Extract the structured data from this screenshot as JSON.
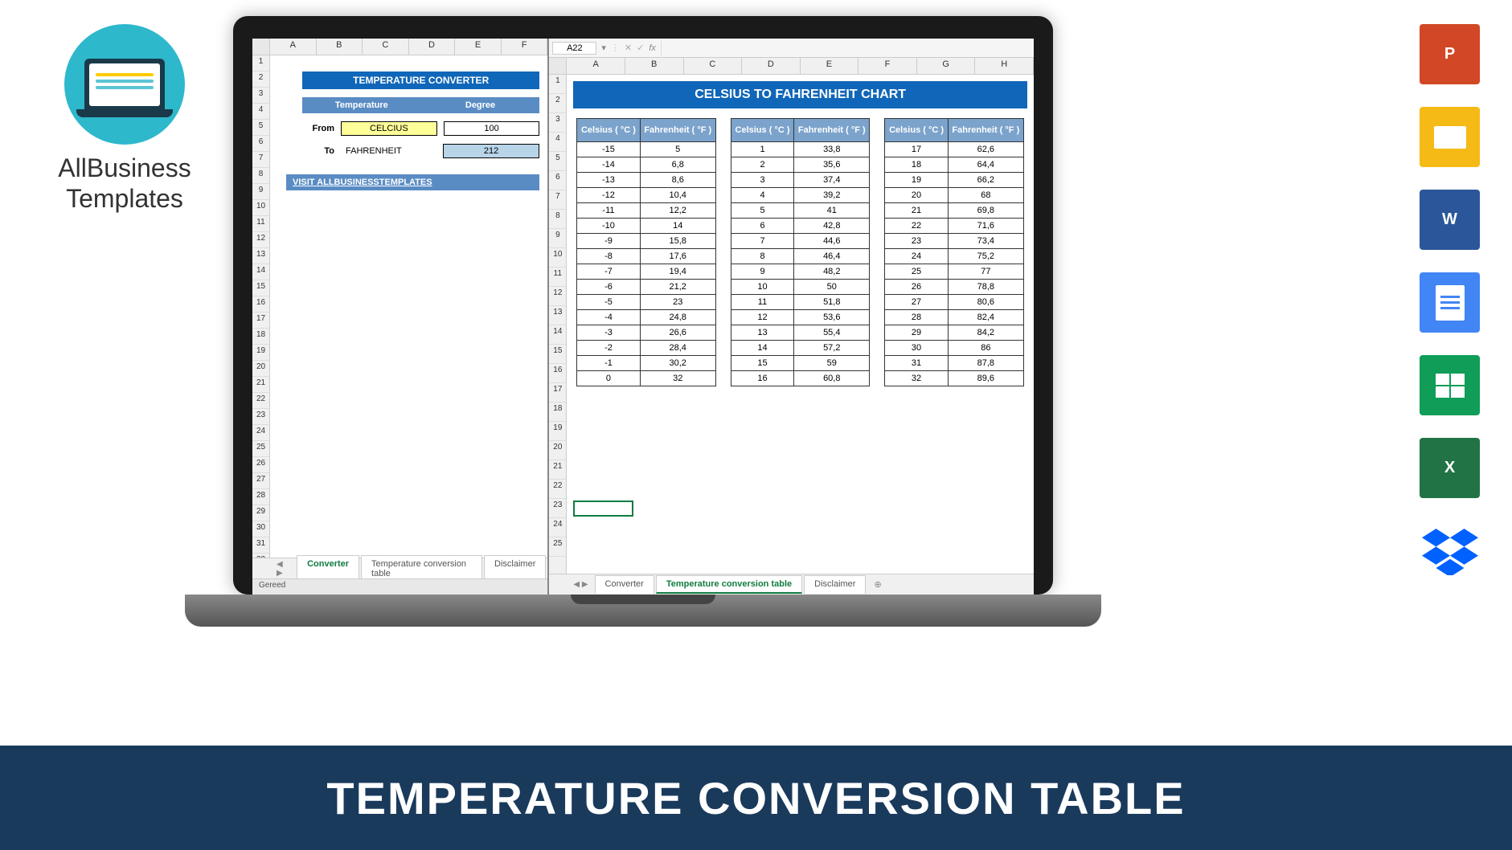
{
  "logo": {
    "text_line1": "AllBusiness",
    "text_line2": "Templates"
  },
  "left_sheet": {
    "columns": [
      "A",
      "B",
      "C",
      "D",
      "E",
      "F"
    ],
    "row_count": 36,
    "converter_title": "TEMPERATURE CONVERTER",
    "header_temp": "Temperature",
    "header_deg": "Degree",
    "from_label": "From",
    "from_temp": "CELCIUS",
    "from_deg": "100",
    "to_label": "To",
    "to_temp": "FAHRENHEIT",
    "to_deg": "212",
    "visit_link": "VISIT ALLBUSINESSTEMPLATES",
    "tabs": [
      "Converter",
      "Temperature conversion table",
      "Disclaimer"
    ],
    "active_tab": 0,
    "status": "Gereed"
  },
  "right_sheet": {
    "name_box": "A22",
    "fx_label": "fx",
    "columns": [
      "A",
      "B",
      "C",
      "D",
      "E",
      "F",
      "G",
      "H"
    ],
    "row_count": 25,
    "chart_title": "CELSIUS TO FAHRENHEIT CHART",
    "col_celsius": "Celsius ( °C )",
    "col_fahrenheit": "Fahrenheit  ( °F )",
    "table1": [
      {
        "c": "-15",
        "f": "5"
      },
      {
        "c": "-14",
        "f": "6,8"
      },
      {
        "c": "-13",
        "f": "8,6"
      },
      {
        "c": "-12",
        "f": "10,4"
      },
      {
        "c": "-11",
        "f": "12,2"
      },
      {
        "c": "-10",
        "f": "14"
      },
      {
        "c": "-9",
        "f": "15,8"
      },
      {
        "c": "-8",
        "f": "17,6"
      },
      {
        "c": "-7",
        "f": "19,4"
      },
      {
        "c": "-6",
        "f": "21,2"
      },
      {
        "c": "-5",
        "f": "23"
      },
      {
        "c": "-4",
        "f": "24,8"
      },
      {
        "c": "-3",
        "f": "26,6"
      },
      {
        "c": "-2",
        "f": "28,4"
      },
      {
        "c": "-1",
        "f": "30,2"
      },
      {
        "c": "0",
        "f": "32"
      }
    ],
    "table2": [
      {
        "c": "1",
        "f": "33,8"
      },
      {
        "c": "2",
        "f": "35,6"
      },
      {
        "c": "3",
        "f": "37,4"
      },
      {
        "c": "4",
        "f": "39,2"
      },
      {
        "c": "5",
        "f": "41"
      },
      {
        "c": "6",
        "f": "42,8"
      },
      {
        "c": "7",
        "f": "44,6"
      },
      {
        "c": "8",
        "f": "46,4"
      },
      {
        "c": "9",
        "f": "48,2"
      },
      {
        "c": "10",
        "f": "50"
      },
      {
        "c": "11",
        "f": "51,8"
      },
      {
        "c": "12",
        "f": "53,6"
      },
      {
        "c": "13",
        "f": "55,4"
      },
      {
        "c": "14",
        "f": "57,2"
      },
      {
        "c": "15",
        "f": "59"
      },
      {
        "c": "16",
        "f": "60,8"
      }
    ],
    "table3": [
      {
        "c": "17",
        "f": "62,6"
      },
      {
        "c": "18",
        "f": "64,4"
      },
      {
        "c": "19",
        "f": "66,2"
      },
      {
        "c": "20",
        "f": "68"
      },
      {
        "c": "21",
        "f": "69,8"
      },
      {
        "c": "22",
        "f": "71,6"
      },
      {
        "c": "23",
        "f": "73,4"
      },
      {
        "c": "24",
        "f": "75,2"
      },
      {
        "c": "25",
        "f": "77"
      },
      {
        "c": "26",
        "f": "78,8"
      },
      {
        "c": "27",
        "f": "80,6"
      },
      {
        "c": "28",
        "f": "82,4"
      },
      {
        "c": "29",
        "f": "84,2"
      },
      {
        "c": "30",
        "f": "86"
      },
      {
        "c": "31",
        "f": "87,8"
      },
      {
        "c": "32",
        "f": "89,6"
      }
    ],
    "tabs": [
      "Converter",
      "Temperature conversion table",
      "Disclaimer"
    ],
    "active_tab": 1
  },
  "file_icons": [
    "powerpoint",
    "google-slides",
    "word",
    "google-docs",
    "google-sheets",
    "excel",
    "dropbox"
  ],
  "banner_text": "TEMPERATURE CONVERSION TABLE"
}
